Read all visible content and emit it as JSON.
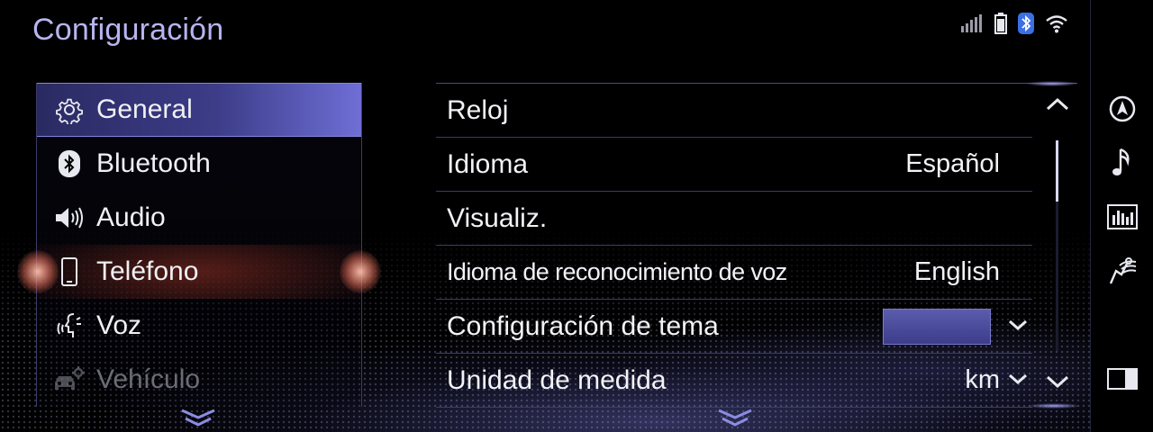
{
  "header": {
    "title": "Configuración"
  },
  "status": {
    "icons": [
      "signal-bars-icon",
      "battery-icon",
      "bluetooth-icon",
      "wifi-icon"
    ],
    "bluetooth_color": "#3b6fe6"
  },
  "menu": {
    "items": [
      {
        "label": "General",
        "icon": "gear-icon",
        "state": "selected"
      },
      {
        "label": "Bluetooth",
        "icon": "bluetooth-icon",
        "state": "normal"
      },
      {
        "label": "Audio",
        "icon": "speaker-icon",
        "state": "normal"
      },
      {
        "label": "Teléfono",
        "icon": "phone-icon",
        "state": "highlight"
      },
      {
        "label": "Voz",
        "icon": "voice-icon",
        "state": "normal"
      },
      {
        "label": "Vehículo",
        "icon": "vehicle-settings-icon",
        "state": "disabled"
      }
    ]
  },
  "settings": {
    "rows": [
      {
        "label": "Reloj",
        "value": ""
      },
      {
        "label": "Idioma",
        "value": "Español"
      },
      {
        "label": "Visualiz.",
        "value": ""
      },
      {
        "label": "Idioma de reconocimiento de voz",
        "value": "English"
      },
      {
        "label": "Configuración de tema",
        "value": ""
      },
      {
        "label": "Unidad de medida",
        "value": "km"
      }
    ],
    "theme_color": "#4a4aa0"
  },
  "sidebar": {
    "icons": [
      "navigation-icon",
      "music-note-icon",
      "equalizer-icon",
      "climate-seat-icon",
      "split-screen-icon"
    ]
  },
  "colors": {
    "accent": "#b7b4f0",
    "selected": "#3c3c88",
    "highlight": "#e06a58"
  }
}
